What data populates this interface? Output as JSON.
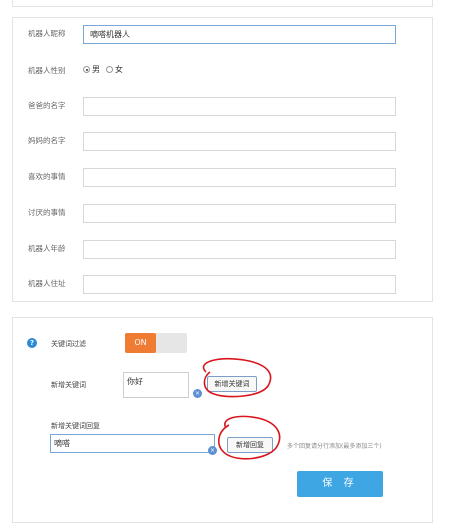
{
  "profile": {
    "fields": [
      {
        "label": "机器人昵称",
        "value": "嘀嗒机器人"
      },
      {
        "label": "机器人性别"
      },
      {
        "label": "爸爸的名字",
        "value": ""
      },
      {
        "label": "妈妈的名字",
        "value": ""
      },
      {
        "label": "喜欢的事情",
        "value": ""
      },
      {
        "label": "讨厌的事情",
        "value": ""
      },
      {
        "label": "机器人年龄",
        "value": ""
      },
      {
        "label": "机器人住址",
        "value": ""
      }
    ],
    "gender_options": [
      {
        "label": "男",
        "checked": true
      },
      {
        "label": "女",
        "checked": false
      }
    ]
  },
  "settings": {
    "keyword_filter_label": "关键词过滤",
    "toggle_label": "ON",
    "new_keyword_label": "新增关键词",
    "keyword_value": "你好",
    "add_keyword_button": "新增关键词",
    "reply_label": "新增关键词回复",
    "reply_value": "嘀嗒",
    "add_reply_button": "新增回复",
    "reply_hint": "多个回复请分行添加(最多添加三个)",
    "save_button": "保 存"
  },
  "colors": {
    "toggle_on": "#f07b33",
    "save": "#3ea6e3",
    "annotation": "#d9151d"
  }
}
